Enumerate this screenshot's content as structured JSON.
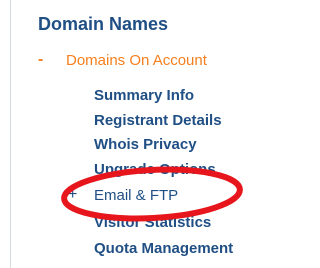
{
  "nav": {
    "section_title": "Domain Names",
    "group": {
      "toggle": "-",
      "label": "Domains On Account"
    },
    "items": [
      {
        "label": "Summary Info"
      },
      {
        "label": "Registrant Details"
      },
      {
        "label": "Whois Privacy"
      },
      {
        "label": "Upgrade Options"
      },
      {
        "toggle": "+",
        "label": "Email & FTP"
      },
      {
        "label": "Visitor Statistics"
      },
      {
        "label": "Quota Management"
      }
    ]
  },
  "colors": {
    "title": "#1f4f84",
    "group": "#f57f1f",
    "link": "#1f4f84",
    "annotation": "#e6161c"
  }
}
